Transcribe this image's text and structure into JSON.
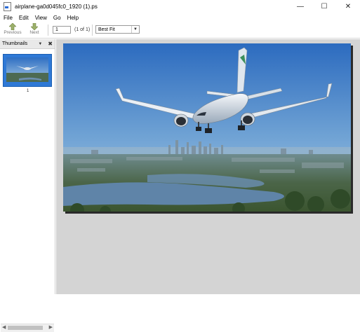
{
  "window": {
    "title": "airplane-ga0d045fc0_1920 (1).ps",
    "controls": {
      "minimize": "—",
      "maximize": "☐",
      "close": "✕"
    }
  },
  "menu": {
    "items": [
      "File",
      "Edit",
      "View",
      "Go",
      "Help"
    ]
  },
  "toolbar": {
    "previous_label": "Previous",
    "next_label": "Next",
    "page_value": "1",
    "page_of": "(1 of 1)",
    "zoom_value": "Best Fit"
  },
  "thumbnails": {
    "title": "Thumbnails",
    "pages": [
      {
        "label": "1",
        "selected": true
      }
    ]
  },
  "document": {
    "image_subject": "airplane-over-city",
    "colors": {
      "sky_top": "#2f6fc2",
      "sky_bottom": "#9cc3e2",
      "river": "#5f84a8",
      "trees": "#3e5a3a",
      "plane_body": "#e8eef5"
    }
  },
  "colors": {
    "thumb_selected": "#2f79d6",
    "workspace_bg": "#d4d4d4",
    "toolbar_icon": "#8aa05a"
  }
}
